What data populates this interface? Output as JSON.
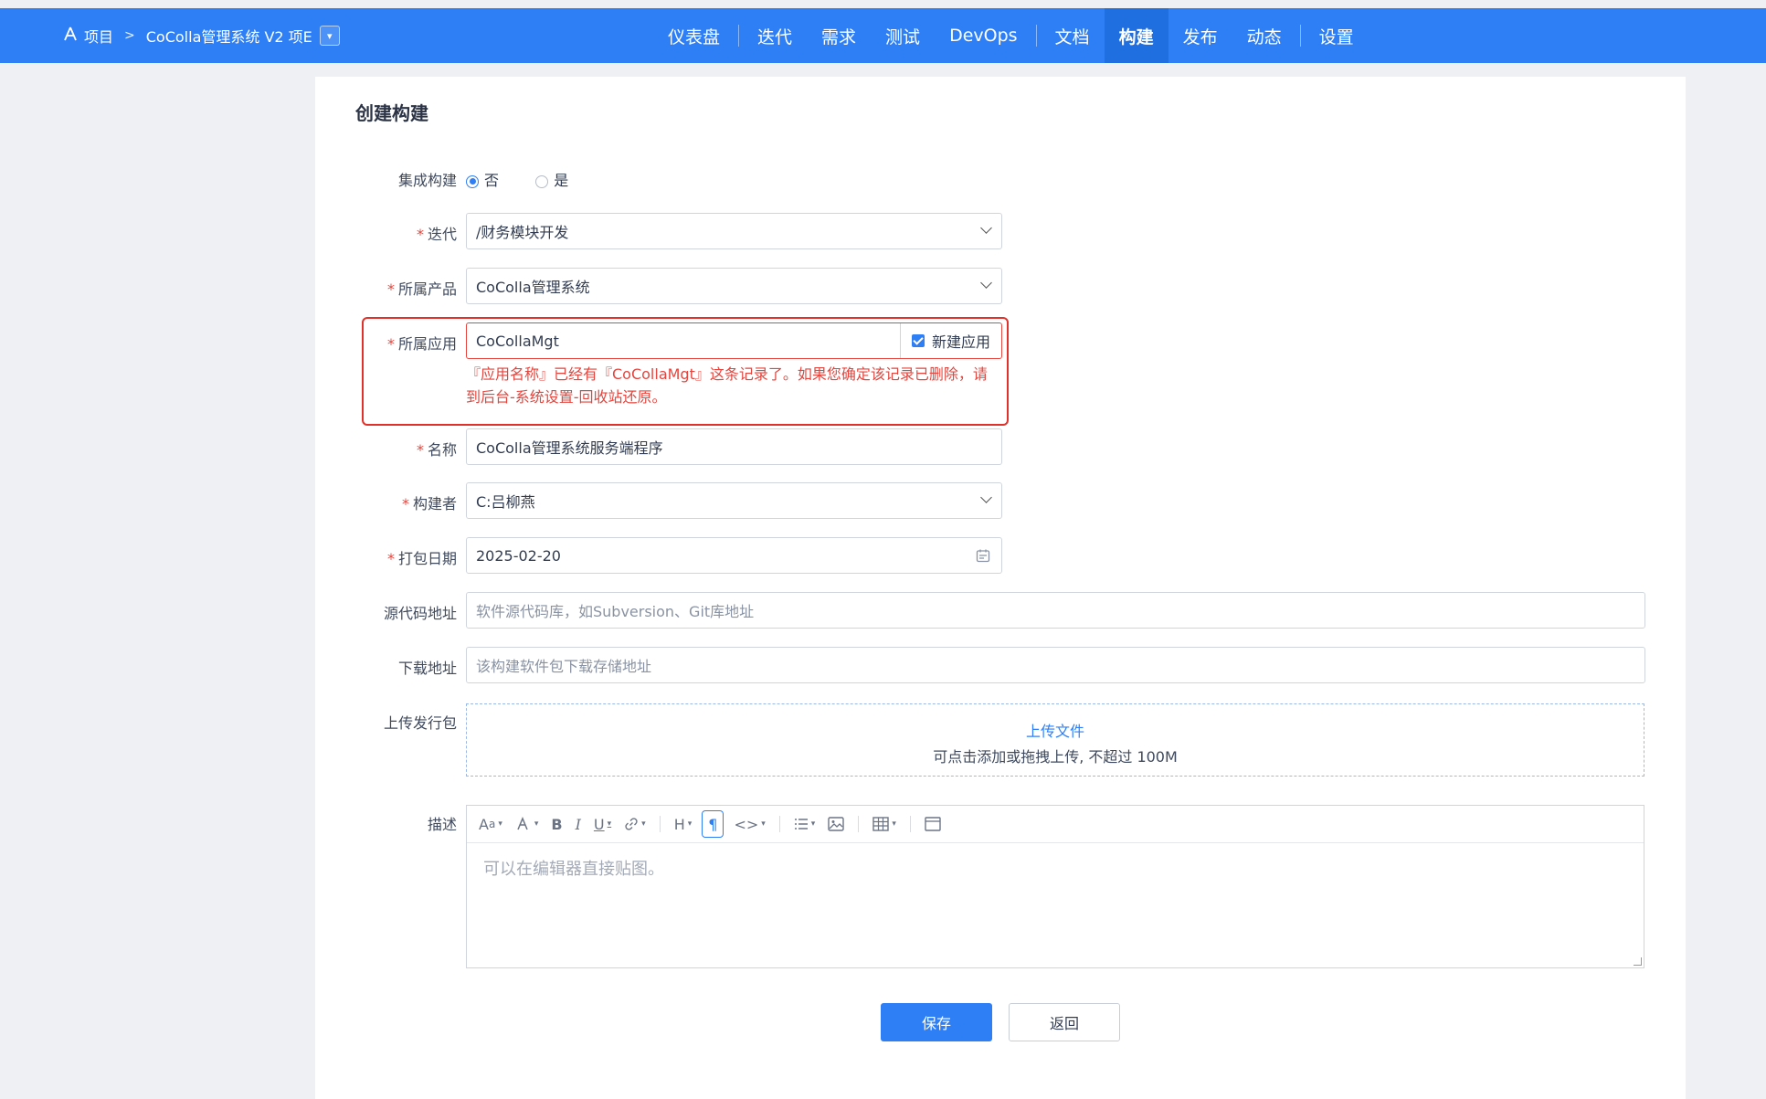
{
  "header": {
    "breadcrumb": {
      "project": "项目",
      "separator": ">",
      "name": "CoColla管理系统 V2 项E"
    },
    "nav": [
      {
        "label": "仪表盘"
      },
      {
        "label": "迭代"
      },
      {
        "label": "需求"
      },
      {
        "label": "测试"
      },
      {
        "label": "DevOps"
      },
      {
        "label": "文档"
      },
      {
        "label": "构建",
        "active": true
      },
      {
        "label": "发布"
      },
      {
        "label": "动态"
      },
      {
        "label": "设置"
      }
    ]
  },
  "form": {
    "title": "创建构建",
    "required_mark": "*",
    "integrated": {
      "label": "集成构建",
      "option_no": "否",
      "option_yes": "是",
      "selected": "否"
    },
    "iteration": {
      "label": "迭代",
      "value": "/财务模块开发"
    },
    "product": {
      "label": "所属产品",
      "value": "CoColla管理系统"
    },
    "app": {
      "label": "所属应用",
      "value": "CoCollaMgt",
      "checkbox_label": "新建应用",
      "checked": true,
      "error_line1": "『应用名称』已经有『CoCollaMgt』这条记录了。如果您确定该记录已删除，请",
      "error_line2": "到后台-系统设置-回收站还原。"
    },
    "name": {
      "label": "名称",
      "value": "CoColla管理系统服务端程序"
    },
    "builder": {
      "label": "构建者",
      "value": "C:吕柳燕"
    },
    "date": {
      "label": "打包日期",
      "value": "2025-02-20"
    },
    "source": {
      "label": "源代码地址",
      "placeholder": "软件源代码库，如Subversion、Git库地址"
    },
    "download": {
      "label": "下载地址",
      "placeholder": "该构建软件包下载存储地址"
    },
    "upload": {
      "label": "上传发行包",
      "link": "上传文件",
      "tip": "可点击添加或拖拽上传, 不超过 100M"
    },
    "description": {
      "label": "描述",
      "placeholder": "可以在编辑器直接贴图。"
    },
    "save_label": "保存",
    "back_label": "返回"
  },
  "toolbar_icons": [
    "font-size-icon",
    "font-color-icon",
    "bold-icon",
    "italic-icon",
    "underline-icon",
    "link-icon",
    "heading-icon",
    "paragraph-icon",
    "code-icon",
    "list-icon",
    "image-icon",
    "table-icon",
    "fullscreen-icon"
  ]
}
